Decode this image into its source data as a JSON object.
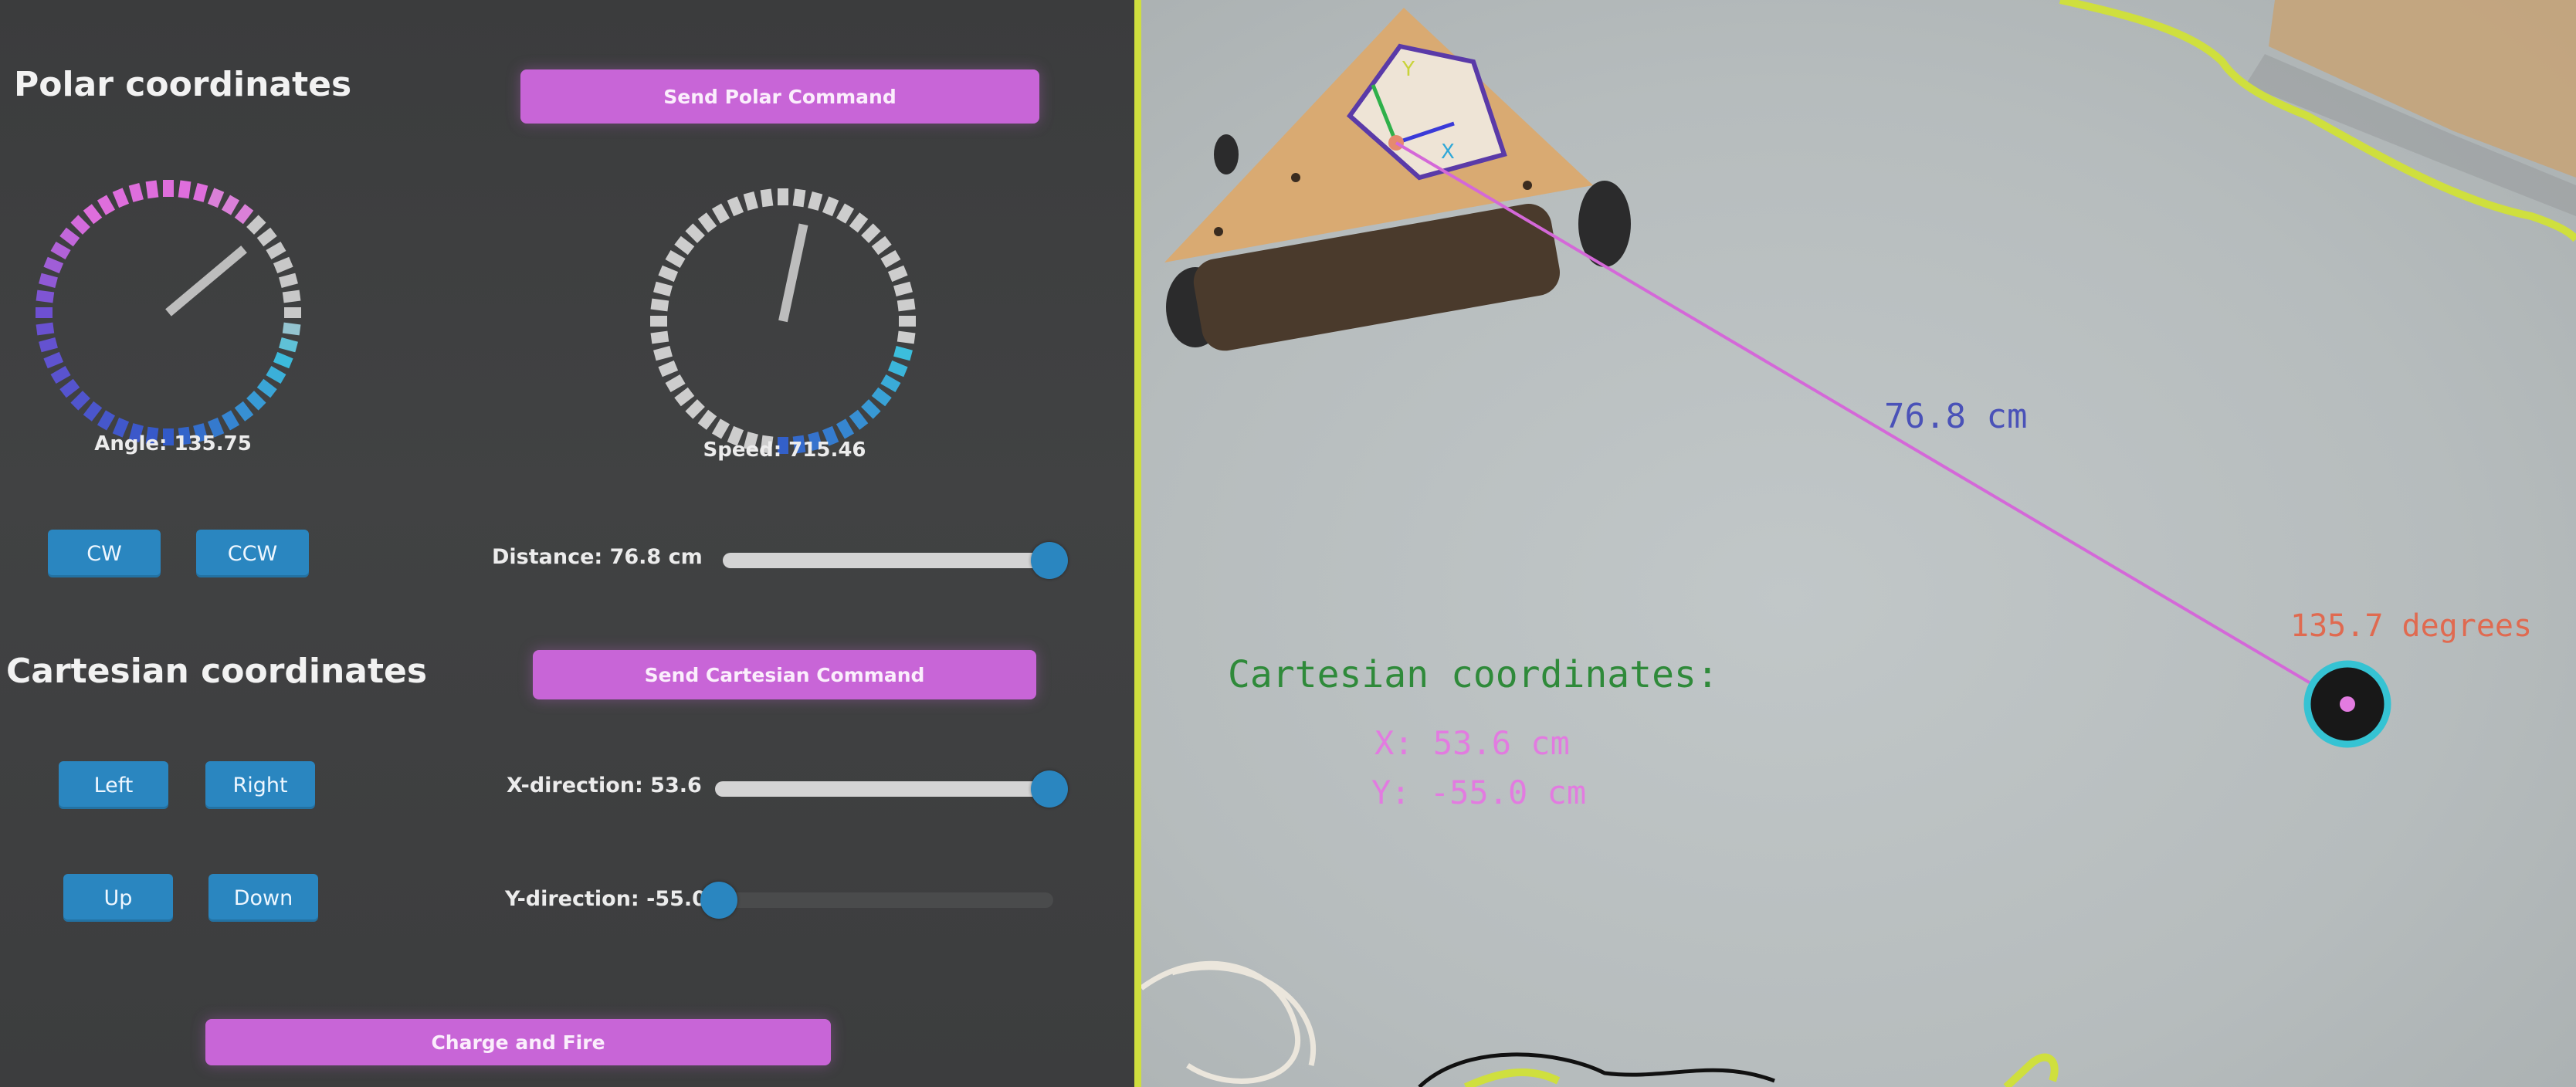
{
  "polar": {
    "heading": "Polar coordinates",
    "send_button": "Send Polar Command",
    "angle_label": "Angle: 135.75",
    "angle_value": 135.75,
    "speed_label": "Speed: 715.46",
    "speed_value": 715.46,
    "cw_button": "CW",
    "ccw_button": "CCW",
    "distance_label": "Distance: 76.8 cm",
    "distance_slider_fraction": 0.98
  },
  "cartesian": {
    "heading": "Cartesian coordinates",
    "send_button": "Send Cartesian Command",
    "left_button": "Left",
    "right_button": "Right",
    "up_button": "Up",
    "down_button": "Down",
    "x_label": "X-direction: 53.6",
    "x_slider_fraction": 0.97,
    "y_label": "Y-direction: -55.0",
    "y_slider_fraction": 0.03
  },
  "fire_button": "Charge and Fire",
  "camera": {
    "distance_text": "76.8 cm",
    "degrees_text": "135.7 degrees",
    "cartesian_title": "Cartesian coordinates:",
    "x_text": "X: 53.6 cm",
    "y_text": "Y: -55.0 cm",
    "axis_x_label": "X",
    "axis_y_label": "Y"
  },
  "colors": {
    "button_pink": "#c865d7",
    "button_blue": "#2a86c0",
    "cv_line": "#d468d8",
    "cv_distance": "#4a52b8",
    "cv_title": "#2f8a3a",
    "cv_coords": "#e27be0",
    "cv_degrees": "#e06a50",
    "boundary": "#cfdf3e"
  },
  "icons": {
    "target": "target-puck-icon",
    "robot": "robot-marker-icon"
  }
}
